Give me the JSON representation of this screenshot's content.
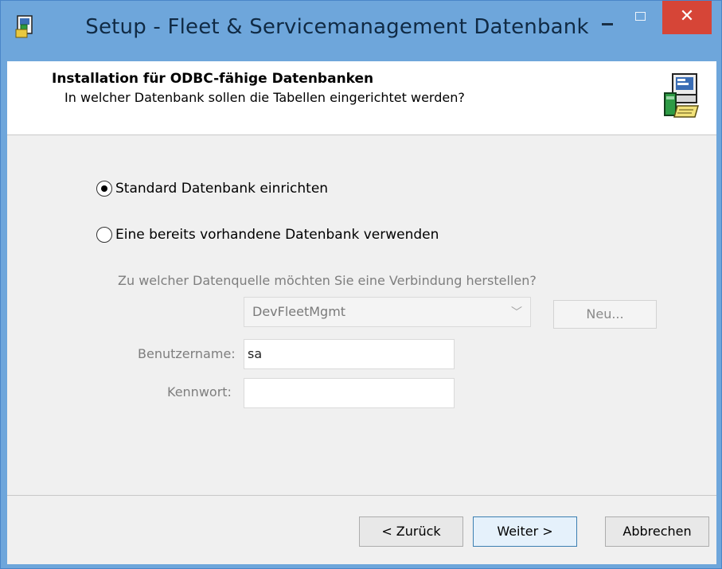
{
  "window": {
    "title": "Setup - Fleet & Servicemanagement Datenbank",
    "minimize_icon": "minimize-icon",
    "maximize_icon": "maximize-icon",
    "close_symbol": "✕"
  },
  "header": {
    "title": "Installation für ODBC-fähige Datenbanken",
    "subtitle": "In welcher Datenbank sollen die Tabellen eingerichtet werden?",
    "icon": "computer-setup-icon"
  },
  "options": {
    "standard_label": "Standard Datenbank einrichten",
    "standard_selected": true,
    "existing_label": "Eine bereits vorhandene Datenbank verwenden",
    "existing_selected": false
  },
  "datasource": {
    "question": "Zu welcher Datenquelle möchten Sie eine Verbindung herstellen?",
    "selected": "DevFleetMgmt",
    "new_button": "Neu..."
  },
  "credentials": {
    "username_label": "Benutzername:",
    "username_value": "sa",
    "password_label": "Kennwort:",
    "password_value": ""
  },
  "footer": {
    "back_button": "< Zurück",
    "next_button": "Weiter >",
    "cancel_button": "Abbrechen"
  }
}
